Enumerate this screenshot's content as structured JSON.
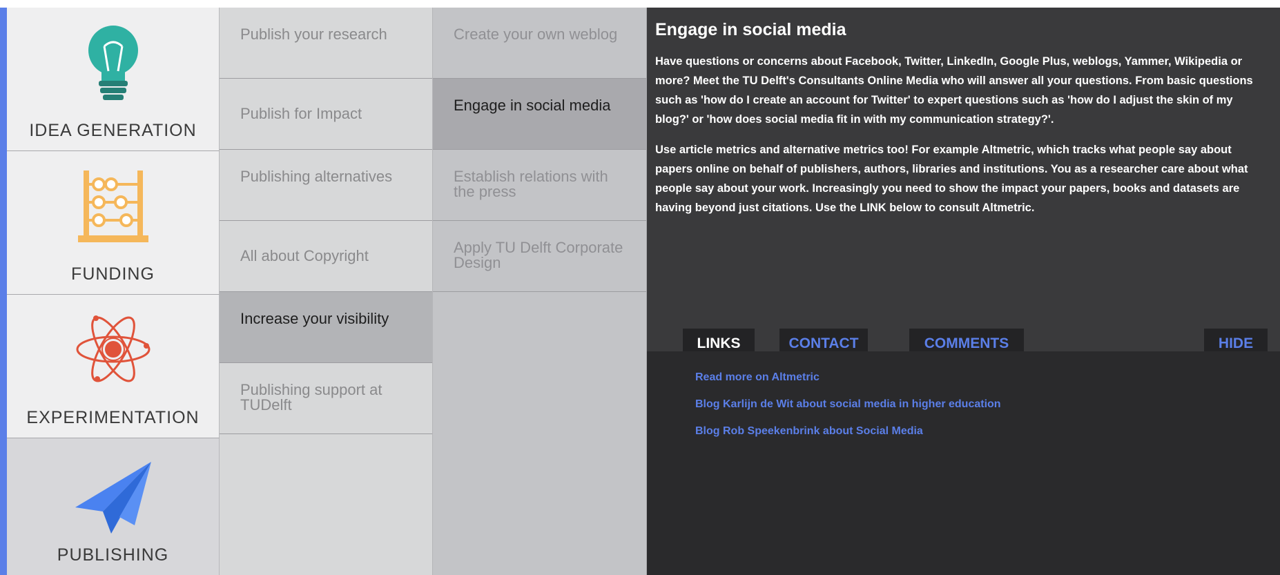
{
  "phases": [
    {
      "label": "IDEA GENERATION",
      "icon": "lightbulb-icon"
    },
    {
      "label": "FUNDING",
      "icon": "abacus-icon"
    },
    {
      "label": "EXPERIMENTATION",
      "icon": "atom-icon"
    },
    {
      "label": "PUBLISHING",
      "icon": "paper-plane-icon"
    }
  ],
  "column2": [
    "Publish your research",
    "Publish for Impact",
    "Publishing alternatives",
    "All about Copyright",
    "Increase your visibility",
    "Publishing support at TUDelft"
  ],
  "column3": [
    "Create your own weblog",
    "Engage in social media",
    "Establish relations with the press",
    "Apply TU Delft Corporate Design"
  ],
  "panel": {
    "title": "Engage in social media",
    "paragraph1": "Have questions or concerns about Facebook, Twitter, LinkedIn, Google Plus, weblogs, Yammer, Wikipedia or more? Meet the TU Delft's Consultants Online Media who will answer all your questions. From basic questions such as 'how do I create an account for Twitter' to expert questions such as 'how do I adjust the skin of my blog?' or 'how does social media fit in with my communication strategy?'.",
    "paragraph2": "Use article metrics and alternative metrics too! For example Altmetric, which tracks what people say about papers online on behalf of publishers, authors, libraries and institutions. You as a researcher care about what people say about your work. Increasingly you need to show the impact your papers, books and datasets are having beyond just citations. Use the LINK below to consult Altmetric."
  },
  "tabs": {
    "links": "LINKS",
    "contact": "CONTACT",
    "comments": "COMMENTS",
    "hide": "HIDE"
  },
  "links": [
    "Read more on Altmetric",
    "Blog Karlijn de Wit about social media in higher education",
    "Blog Rob Speekenbrink about Social Media"
  ],
  "colors": {
    "accent": "#5b7fe8",
    "panel_bg": "#3a3a3c",
    "links_bg": "#2a2a2c"
  }
}
